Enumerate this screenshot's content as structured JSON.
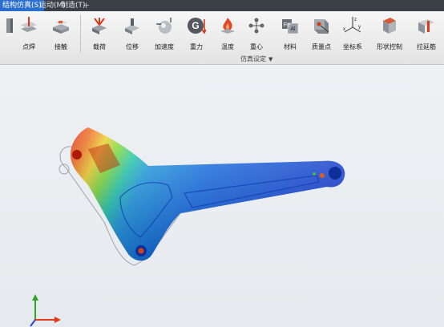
{
  "menu": {
    "tabs": [
      "结构仿真(S)",
      "运动(M)",
      "制造(T)"
    ],
    "plus": "+"
  },
  "toolbar": {
    "tools": [
      {
        "label": "",
        "icon": "plate-icon"
      },
      {
        "label": "点焊",
        "icon": "spot-weld-icon"
      },
      {
        "label": "接触",
        "icon": "contact-icon"
      },
      {
        "label": "载荷",
        "icon": "load-icon"
      },
      {
        "label": "位移",
        "icon": "displacement-icon"
      },
      {
        "label": "加速度",
        "icon": "acceleration-icon"
      },
      {
        "label": "重力",
        "icon": "gravity-icon"
      },
      {
        "label": "温度",
        "icon": "temperature-icon"
      },
      {
        "label": "重心",
        "icon": "center-of-gravity-icon"
      },
      {
        "label": "材料",
        "icon": "material-icon"
      },
      {
        "label": "质量点",
        "icon": "mass-point-icon"
      },
      {
        "label": "坐标系",
        "icon": "coordinate-system-icon"
      },
      {
        "label": "形状控制",
        "icon": "shape-control-icon"
      },
      {
        "label": "拉延筋",
        "icon": "draw-bead-icon"
      }
    ],
    "group_title": "仿真设定",
    "group_arrow": "▼",
    "material_icon_text": {
      "fe": "Fe",
      "al": "Al"
    },
    "gravity_letter": "G",
    "axes_letters": {
      "z": "z",
      "x": "x",
      "y": "y"
    }
  },
  "colors": {
    "menubar": "#3b3f46",
    "active_tab": "#2a6fd0",
    "stress_high": "#e02010",
    "stress_low": "#1040e0"
  }
}
